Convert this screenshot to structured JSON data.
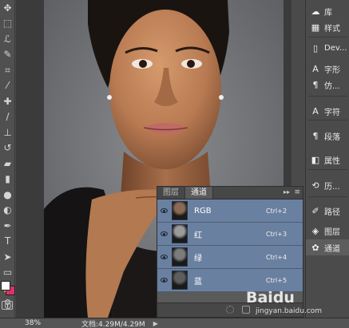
{
  "toolbar": {
    "tools": [
      {
        "name": "move-tool",
        "glyph": "✥"
      },
      {
        "name": "marquee-tool",
        "glyph": "⬚"
      },
      {
        "name": "lasso-tool",
        "glyph": "ℒ"
      },
      {
        "name": "quick-select-tool",
        "glyph": "✎"
      },
      {
        "name": "crop-tool",
        "glyph": "⌗"
      },
      {
        "name": "eyedropper-tool",
        "glyph": "⁄"
      },
      {
        "name": "spot-healing-tool",
        "glyph": "✚"
      },
      {
        "name": "brush-tool",
        "glyph": "∕"
      },
      {
        "name": "clone-stamp-tool",
        "glyph": "⊥"
      },
      {
        "name": "history-brush-tool",
        "glyph": "↺"
      },
      {
        "name": "eraser-tool",
        "glyph": "▰"
      },
      {
        "name": "gradient-tool",
        "glyph": "▮"
      },
      {
        "name": "blur-tool",
        "glyph": "●"
      },
      {
        "name": "dodge-tool",
        "glyph": "◐"
      },
      {
        "name": "pen-tool",
        "glyph": "✒"
      },
      {
        "name": "type-tool",
        "glyph": "T"
      },
      {
        "name": "path-select-tool",
        "glyph": "➤"
      },
      {
        "name": "shape-tool",
        "glyph": "▭"
      },
      {
        "name": "hand-tool",
        "glyph": "✋"
      },
      {
        "name": "zoom-tool",
        "glyph": "⚲"
      }
    ],
    "foreground_color": "#ffffff",
    "background_color": "#d6336c"
  },
  "dock": {
    "items": [
      {
        "name": "libraries",
        "icon": "library-icon",
        "glyph": "☁",
        "label": "库"
      },
      {
        "name": "styles",
        "icon": "styles-icon",
        "glyph": "▦",
        "label": "样式"
      },
      {
        "name": "device-preview",
        "icon": "device-icon",
        "glyph": "▯",
        "label": "Dev..."
      },
      {
        "name": "character",
        "icon": "character-icon",
        "glyph": "A",
        "label": "字形"
      },
      {
        "name": "paragraph-styles",
        "icon": "paragraph-style-icon",
        "glyph": "¶",
        "label": "仿..."
      },
      {
        "name": "character-panel",
        "icon": "character-panel-icon",
        "glyph": "A",
        "label": "字符"
      },
      {
        "name": "paragraph",
        "icon": "paragraph-icon",
        "glyph": "¶",
        "label": "段落"
      },
      {
        "name": "properties",
        "icon": "properties-icon",
        "glyph": "◧",
        "label": "属性"
      },
      {
        "name": "history",
        "icon": "history-icon",
        "glyph": "⟲",
        "label": "历..."
      },
      {
        "name": "paths",
        "icon": "paths-icon",
        "glyph": "✐",
        "label": "路径"
      },
      {
        "name": "layers",
        "icon": "layers-icon",
        "glyph": "◈",
        "label": "图层"
      },
      {
        "name": "channels",
        "icon": "channels-icon",
        "glyph": "✿",
        "label": "通道"
      }
    ],
    "active": "channels"
  },
  "channels_panel": {
    "tabs": [
      {
        "label": "图层",
        "active": false
      },
      {
        "label": "通道",
        "active": true
      }
    ],
    "collapse_glyph": "▸▸",
    "menu_glyph": "≡",
    "rows": [
      {
        "label": "RGB",
        "shortcut": "Ctrl+2"
      },
      {
        "label": "红",
        "shortcut": "Ctrl+3"
      },
      {
        "label": "绿",
        "shortcut": "Ctrl+4"
      },
      {
        "label": "蓝",
        "shortcut": "Ctrl+5"
      }
    ],
    "row_color": "#6a80a0"
  },
  "status": {
    "zoom": "38%",
    "doc_info": "文档:4.29M/4.29M",
    "arrow": "▶"
  },
  "watermark": {
    "brand": "Baidu",
    "site": "jingyan.baidu.com"
  }
}
